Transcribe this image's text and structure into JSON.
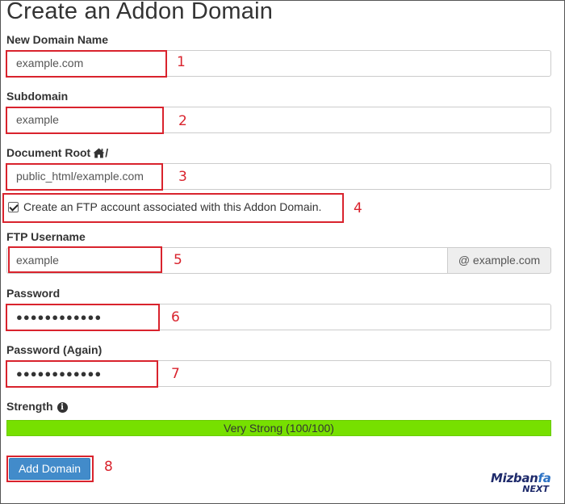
{
  "page_title": "Create an Addon Domain",
  "fields": {
    "new_domain": {
      "label": "New Domain Name",
      "value": "example.com",
      "marker": "1"
    },
    "subdomain": {
      "label": "Subdomain",
      "value": "example",
      "marker": "2"
    },
    "document_root": {
      "label": "Document Root",
      "label_suffix": "/",
      "value": "public_html/example.com",
      "marker": "3"
    },
    "ftp_checkbox": {
      "label": "Create an FTP account associated with this Addon Domain.",
      "checked": true,
      "marker": "4"
    },
    "ftp_username": {
      "label": "FTP Username",
      "value": "example",
      "addon": "@ example.com",
      "marker": "5"
    },
    "password": {
      "label": "Password",
      "value": "●●●●●●●●●●●●",
      "marker": "6"
    },
    "password_again": {
      "label": "Password (Again)",
      "value": "●●●●●●●●●●●●",
      "marker": "7"
    }
  },
  "strength": {
    "label": "Strength",
    "text": "Very Strong (100/100)",
    "percent": 100,
    "color": "#77e000"
  },
  "submit": {
    "label": "Add Domain",
    "marker": "8"
  },
  "logo": {
    "main": "Mizban",
    "accent": "fa",
    "sub": "NEXT"
  },
  "colors": {
    "highlight": "#d9232d",
    "primary_button": "#428bca"
  }
}
